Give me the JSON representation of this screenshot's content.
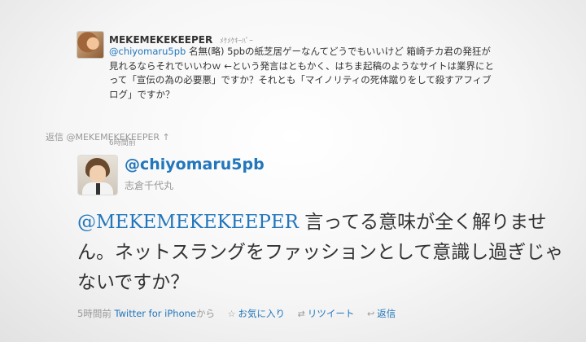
{
  "original_tweet": {
    "screen_name": "MEKEMEKEKEEPER",
    "display_name": "ﾒｹﾒｹｷｰﾊﾟｰ",
    "mention": "@chiyomaru5pb",
    "text": " 名無(略) 5pbの紙芝居ゲーなんてどうでもいいけど 箱崎チカ君の発狂が見れるならそれでいいわｗ ←という発言はともかく、はちま起稿のようなサイトは業界にとって「宣伝の為の必要悪」ですか？それとも「マイノリティの死体蹴りをして殺すアフィブログ」ですか？",
    "time": "6時間前"
  },
  "reply_bar": {
    "label": "返信 @MEKEMEKEKEEPER ↑"
  },
  "tweet": {
    "screen_name": "@chiyomaru5pb",
    "full_name": "志倉千代丸",
    "mention": "@MEKEMEKEKEEPER",
    "text": " 言ってる意味が全く解りません。ネットスラングをファッションとして意識し過ぎじゃないですか？",
    "time": "5時間前",
    "source": "Twitter for iPhone",
    "source_suffix": "から",
    "actions": {
      "favorite": "お気に入り",
      "retweet": "リツイート",
      "reply": "返信"
    }
  },
  "icons": {
    "favorite": "star-icon",
    "retweet": "retweet-icon",
    "reply": "reply-icon"
  },
  "colors": {
    "link": "#2276bb",
    "muted": "#999999",
    "text": "#333333"
  }
}
